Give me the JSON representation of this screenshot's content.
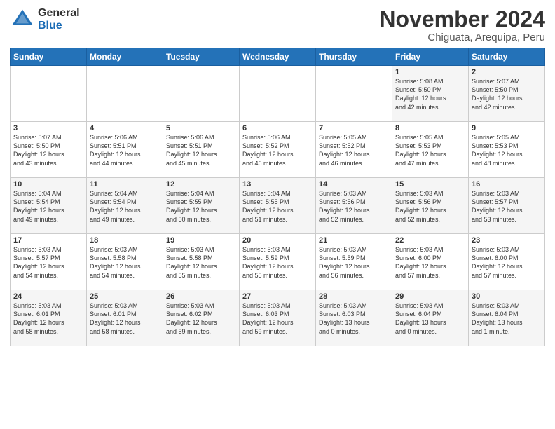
{
  "logo": {
    "general": "General",
    "blue": "Blue"
  },
  "title": "November 2024",
  "location": "Chiguata, Arequipa, Peru",
  "weekdays": [
    "Sunday",
    "Monday",
    "Tuesday",
    "Wednesday",
    "Thursday",
    "Friday",
    "Saturday"
  ],
  "weeks": [
    [
      {
        "day": "",
        "info": ""
      },
      {
        "day": "",
        "info": ""
      },
      {
        "day": "",
        "info": ""
      },
      {
        "day": "",
        "info": ""
      },
      {
        "day": "",
        "info": ""
      },
      {
        "day": "1",
        "info": "Sunrise: 5:08 AM\nSunset: 5:50 PM\nDaylight: 12 hours\nand 42 minutes."
      },
      {
        "day": "2",
        "info": "Sunrise: 5:07 AM\nSunset: 5:50 PM\nDaylight: 12 hours\nand 42 minutes."
      }
    ],
    [
      {
        "day": "3",
        "info": "Sunrise: 5:07 AM\nSunset: 5:50 PM\nDaylight: 12 hours\nand 43 minutes."
      },
      {
        "day": "4",
        "info": "Sunrise: 5:06 AM\nSunset: 5:51 PM\nDaylight: 12 hours\nand 44 minutes."
      },
      {
        "day": "5",
        "info": "Sunrise: 5:06 AM\nSunset: 5:51 PM\nDaylight: 12 hours\nand 45 minutes."
      },
      {
        "day": "6",
        "info": "Sunrise: 5:06 AM\nSunset: 5:52 PM\nDaylight: 12 hours\nand 46 minutes."
      },
      {
        "day": "7",
        "info": "Sunrise: 5:05 AM\nSunset: 5:52 PM\nDaylight: 12 hours\nand 46 minutes."
      },
      {
        "day": "8",
        "info": "Sunrise: 5:05 AM\nSunset: 5:53 PM\nDaylight: 12 hours\nand 47 minutes."
      },
      {
        "day": "9",
        "info": "Sunrise: 5:05 AM\nSunset: 5:53 PM\nDaylight: 12 hours\nand 48 minutes."
      }
    ],
    [
      {
        "day": "10",
        "info": "Sunrise: 5:04 AM\nSunset: 5:54 PM\nDaylight: 12 hours\nand 49 minutes."
      },
      {
        "day": "11",
        "info": "Sunrise: 5:04 AM\nSunset: 5:54 PM\nDaylight: 12 hours\nand 49 minutes."
      },
      {
        "day": "12",
        "info": "Sunrise: 5:04 AM\nSunset: 5:55 PM\nDaylight: 12 hours\nand 50 minutes."
      },
      {
        "day": "13",
        "info": "Sunrise: 5:04 AM\nSunset: 5:55 PM\nDaylight: 12 hours\nand 51 minutes."
      },
      {
        "day": "14",
        "info": "Sunrise: 5:03 AM\nSunset: 5:56 PM\nDaylight: 12 hours\nand 52 minutes."
      },
      {
        "day": "15",
        "info": "Sunrise: 5:03 AM\nSunset: 5:56 PM\nDaylight: 12 hours\nand 52 minutes."
      },
      {
        "day": "16",
        "info": "Sunrise: 5:03 AM\nSunset: 5:57 PM\nDaylight: 12 hours\nand 53 minutes."
      }
    ],
    [
      {
        "day": "17",
        "info": "Sunrise: 5:03 AM\nSunset: 5:57 PM\nDaylight: 12 hours\nand 54 minutes."
      },
      {
        "day": "18",
        "info": "Sunrise: 5:03 AM\nSunset: 5:58 PM\nDaylight: 12 hours\nand 54 minutes."
      },
      {
        "day": "19",
        "info": "Sunrise: 5:03 AM\nSunset: 5:58 PM\nDaylight: 12 hours\nand 55 minutes."
      },
      {
        "day": "20",
        "info": "Sunrise: 5:03 AM\nSunset: 5:59 PM\nDaylight: 12 hours\nand 55 minutes."
      },
      {
        "day": "21",
        "info": "Sunrise: 5:03 AM\nSunset: 5:59 PM\nDaylight: 12 hours\nand 56 minutes."
      },
      {
        "day": "22",
        "info": "Sunrise: 5:03 AM\nSunset: 6:00 PM\nDaylight: 12 hours\nand 57 minutes."
      },
      {
        "day": "23",
        "info": "Sunrise: 5:03 AM\nSunset: 6:00 PM\nDaylight: 12 hours\nand 57 minutes."
      }
    ],
    [
      {
        "day": "24",
        "info": "Sunrise: 5:03 AM\nSunset: 6:01 PM\nDaylight: 12 hours\nand 58 minutes."
      },
      {
        "day": "25",
        "info": "Sunrise: 5:03 AM\nSunset: 6:01 PM\nDaylight: 12 hours\nand 58 minutes."
      },
      {
        "day": "26",
        "info": "Sunrise: 5:03 AM\nSunset: 6:02 PM\nDaylight: 12 hours\nand 59 minutes."
      },
      {
        "day": "27",
        "info": "Sunrise: 5:03 AM\nSunset: 6:03 PM\nDaylight: 12 hours\nand 59 minutes."
      },
      {
        "day": "28",
        "info": "Sunrise: 5:03 AM\nSunset: 6:03 PM\nDaylight: 13 hours\nand 0 minutes."
      },
      {
        "day": "29",
        "info": "Sunrise: 5:03 AM\nSunset: 6:04 PM\nDaylight: 13 hours\nand 0 minutes."
      },
      {
        "day": "30",
        "info": "Sunrise: 5:03 AM\nSunset: 6:04 PM\nDaylight: 13 hours\nand 1 minute."
      }
    ]
  ]
}
